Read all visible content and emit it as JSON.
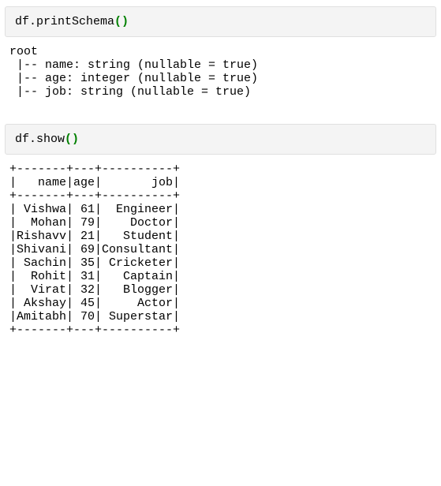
{
  "cell1": {
    "code_prefix": "df.printSchema",
    "paren": "()"
  },
  "output1": "root\n |-- name: string (nullable = true)\n |-- age: integer (nullable = true)\n |-- job: string (nullable = true)",
  "cell2": {
    "code_prefix": "df.show",
    "paren": "()"
  },
  "output2": "+-------+---+----------+\n|   name|age|       job|\n+-------+---+----------+\n| Vishwa| 61|  Engineer|\n|  Mohan| 79|    Doctor|\n|Rishavv| 21|   Student|\n|Shivani| 69|Consultant|\n| Sachin| 35| Cricketer|\n|  Rohit| 31|   Captain|\n|  Virat| 32|   Blogger|\n| Akshay| 45|     Actor|\n|Amitabh| 70| Superstar|\n+-------+---+----------+",
  "chart_data": {
    "type": "table",
    "columns": [
      "name",
      "age",
      "job"
    ],
    "rows": [
      {
        "name": "Vishwa",
        "age": 61,
        "job": "Engineer"
      },
      {
        "name": "Mohan",
        "age": 79,
        "job": "Doctor"
      },
      {
        "name": "Rishavv",
        "age": 21,
        "job": "Student"
      },
      {
        "name": "Shivani",
        "age": 69,
        "job": "Consultant"
      },
      {
        "name": "Sachin",
        "age": 35,
        "job": "Cricketer"
      },
      {
        "name": "Rohit",
        "age": 31,
        "job": "Captain"
      },
      {
        "name": "Virat",
        "age": 32,
        "job": "Blogger"
      },
      {
        "name": "Akshay",
        "age": 45,
        "job": "Actor"
      },
      {
        "name": "Amitabh",
        "age": 70,
        "job": "Superstar"
      }
    ],
    "schema": [
      {
        "field": "name",
        "type": "string",
        "nullable": true
      },
      {
        "field": "age",
        "type": "integer",
        "nullable": true
      },
      {
        "field": "job",
        "type": "string",
        "nullable": true
      }
    ]
  }
}
